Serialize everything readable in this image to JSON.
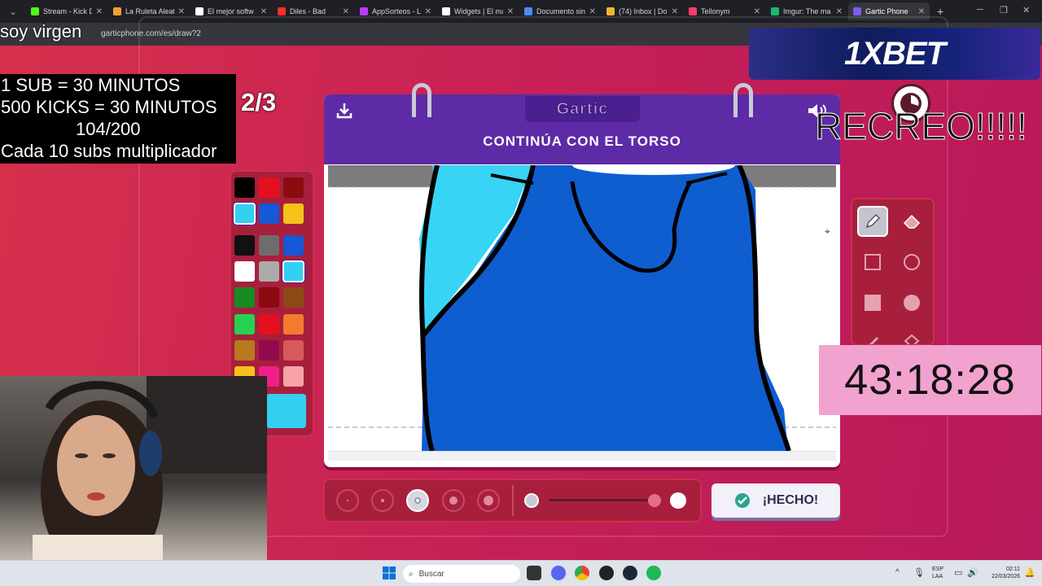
{
  "browser": {
    "tabs": [
      {
        "label": "Stream - Kick D",
        "color": "#53fc18"
      },
      {
        "label": "La Ruleta Aleat",
        "color": "#f0a030"
      },
      {
        "label": "El mejor softw",
        "color": "#ffffff"
      },
      {
        "label": "Diles - Bad",
        "color": "#ff2d2d"
      },
      {
        "label": "AppSorteos - L",
        "color": "#b63cff"
      },
      {
        "label": "Widgets | El ma",
        "color": "#ffffff"
      },
      {
        "label": "Documento sin",
        "color": "#4a8cf7"
      },
      {
        "label": "(74) Inbox | Do",
        "color": "#f2b632"
      },
      {
        "label": "Tellonym",
        "color": "#ff3a6e"
      },
      {
        "label": "Imgur: The ma",
        "color": "#1bb76e"
      },
      {
        "label": "Gartic Phone",
        "color": "#7f5af0"
      }
    ],
    "url": "garticphone.com/es/draw?2"
  },
  "overlays": {
    "caption": "soy virgen",
    "info_lines": [
      "1 SUB      = 30 MINUTOS",
      "500 KICKS = 30 MINUTOS",
      "104/200",
      "Cada 10 subs multiplicador"
    ],
    "recreo": "RECREO!!!!!",
    "timer": "43:18:28",
    "ad_label": "1XBET"
  },
  "game": {
    "round": "2/3",
    "logo": "Gartic",
    "prompt": "CONTINÚA CON EL TORSO",
    "done_label": "¡HECHO!",
    "palette": [
      "#000000",
      "#e5101d",
      "#8b0b10",
      "#33d0f2",
      "#1658d6",
      "#f4c21a",
      "#111111",
      "#6d6d6d",
      "#1658d6",
      "#ffffff",
      "#aaaaaa",
      "#33d0f2",
      "#1a8a25",
      "#8b0b10",
      "#8a4a12",
      "#26d052",
      "#e5101d",
      "#f27b2e",
      "#b87a1e",
      "#920a4e",
      "#d65a5a",
      "#f4c21a",
      "#f01e8a",
      "#f5a2a8"
    ],
    "selected_color": "#33d0f2",
    "brush_sizes": [
      "size-1",
      "size-2",
      "size-3",
      "size-4",
      "size-5"
    ],
    "selected_brush": 2,
    "tools": [
      "pencil-icon",
      "eraser-icon",
      "rectangle-outline-icon",
      "circle-outline-icon",
      "rectangle-fill-icon",
      "circle-fill-icon",
      "line-icon",
      "fill-bucket-icon"
    ]
  },
  "taskbar": {
    "search_placeholder": "Buscar",
    "lang_top": "ESP",
    "lang_bottom": "LAA",
    "time": "02:11",
    "date": "22/03/2026"
  }
}
